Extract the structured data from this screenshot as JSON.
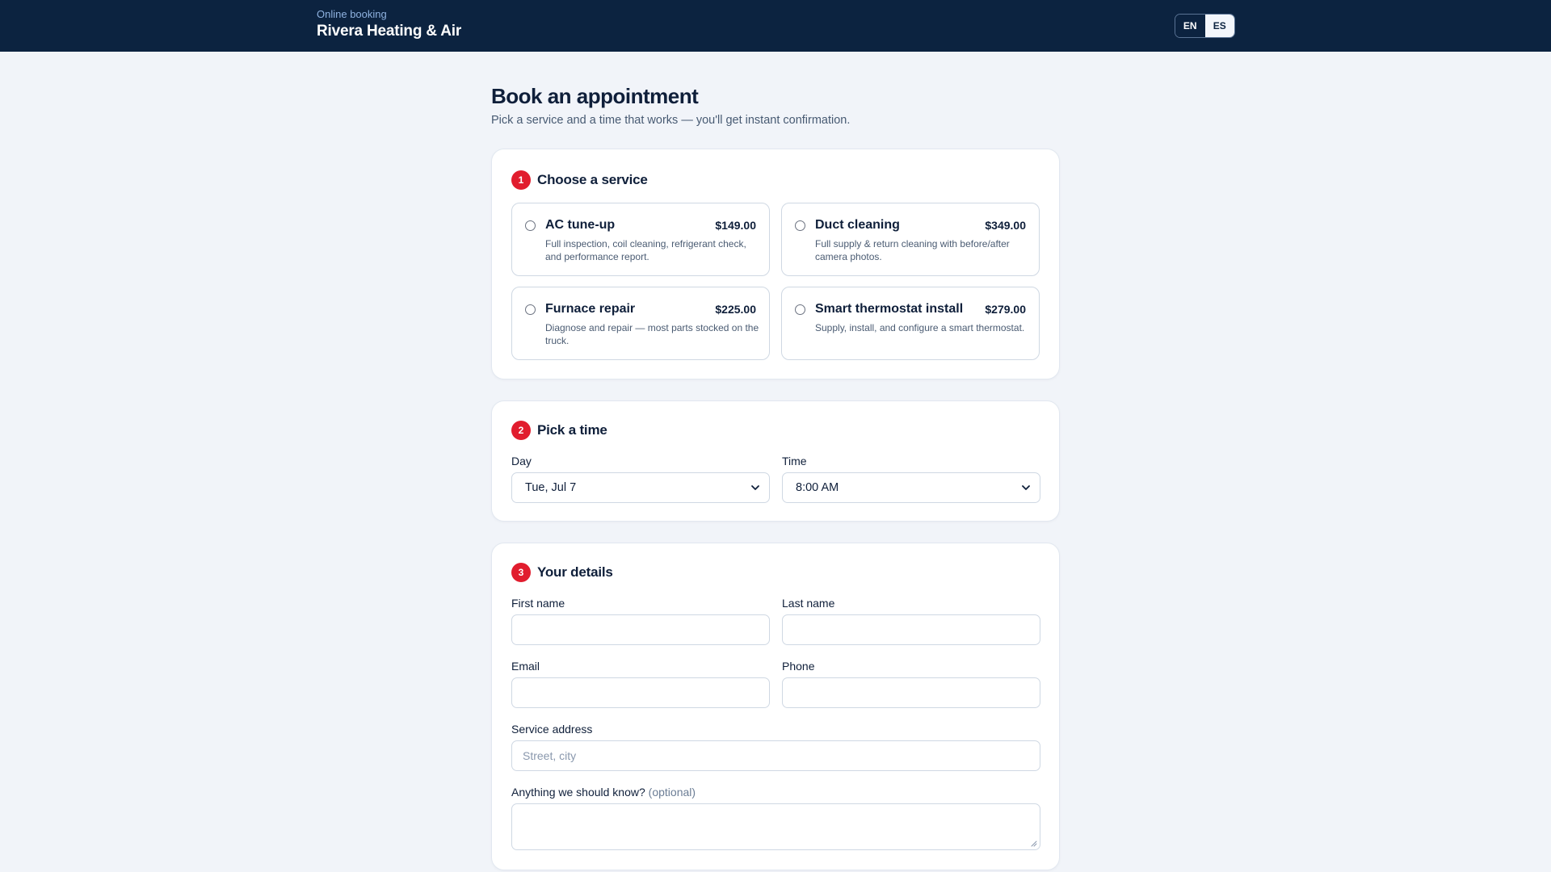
{
  "header": {
    "subtitle": "Online booking",
    "title": "Rivera Heating & Air",
    "languages": [
      "EN",
      "ES"
    ],
    "active_language": "EN",
    "background_color": "#0c2340"
  },
  "page": {
    "title": "Book an appointment",
    "subtitle": "Pick a service and a time that works — you'll get instant confirmation."
  },
  "step1": {
    "number": "1",
    "title": "Choose a service",
    "services": [
      {
        "name": "AC tune-up",
        "price": "$149.00",
        "description": "Full inspection, coil cleaning, refrigerant check, and performance report."
      },
      {
        "name": "Duct cleaning",
        "price": "$349.00",
        "description": "Full supply & return cleaning with before/after camera photos."
      },
      {
        "name": "Furnace repair",
        "price": "$225.00",
        "description": "Diagnose and repair — most parts stocked on the truck."
      },
      {
        "name": "Smart thermostat install",
        "price": "$279.00",
        "description": "Supply, install, and configure a smart thermostat."
      }
    ]
  },
  "step2": {
    "number": "2",
    "title": "Pick a time",
    "day_label": "Day",
    "day_value": "Tue, Jul 7",
    "time_label": "Time",
    "time_value": "8:00 AM"
  },
  "step3": {
    "number": "3",
    "title": "Your details",
    "first_name_label": "First name",
    "last_name_label": "Last name",
    "email_label": "Email",
    "phone_label": "Phone",
    "address_label": "Service address",
    "address_placeholder": "Street, city",
    "notes_label": "Anything we should know?",
    "notes_optional": "(optional)"
  },
  "colors": {
    "accent": "#e11d2e",
    "navy": "#0c2340",
    "page_background": "#f1f4f9"
  }
}
